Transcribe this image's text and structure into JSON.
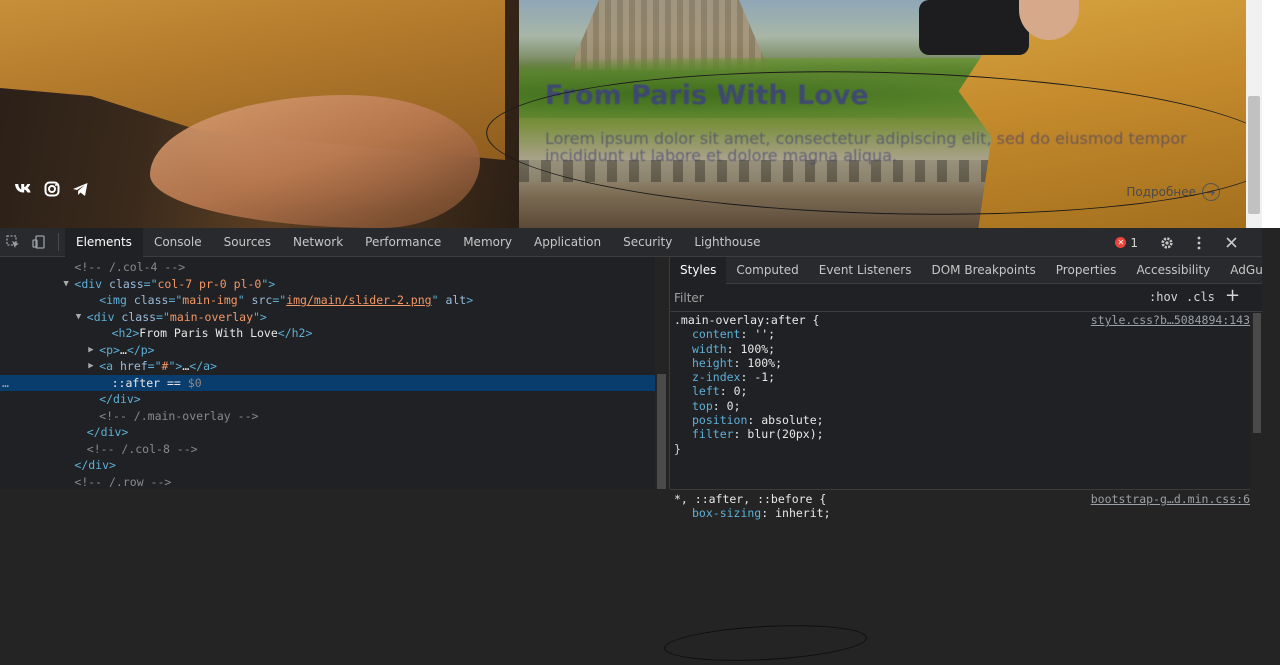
{
  "site": {
    "overlay_title": "From Paris With Love",
    "overlay_text": "Lorem ipsum dolor sit amet, consectetur adipiscing elit, sed do eiusmod tempor incididunt ut labore et dolore magna aliqua.",
    "more_link": "Подробнее",
    "socials": [
      "vk-icon",
      "instagram-icon",
      "telegram-icon"
    ]
  },
  "devtools": {
    "main_tabs": [
      "Elements",
      "Console",
      "Sources",
      "Network",
      "Performance",
      "Memory",
      "Application",
      "Security",
      "Lighthouse"
    ],
    "active_tab": "Elements",
    "error_count": "1",
    "elements_lines": [
      {
        "indent": 6,
        "parts": [
          [
            "cmt",
            "<!-- /.col-4 -->"
          ]
        ]
      },
      {
        "indent": 6,
        "tri": "▼",
        "parts": [
          [
            "tag",
            "<div "
          ],
          [
            "attr",
            "class"
          ],
          [
            "tag",
            "=\""
          ],
          [
            "val",
            "col-7 pr-0 pl-0"
          ],
          [
            "tag",
            "\">"
          ]
        ]
      },
      {
        "indent": 8,
        "parts": [
          [
            "tag",
            "<img "
          ],
          [
            "attr",
            "class"
          ],
          [
            "tag",
            "=\""
          ],
          [
            "val",
            "main-img"
          ],
          [
            "tag",
            "\" "
          ],
          [
            "attr",
            "src"
          ],
          [
            "tag",
            "=\""
          ],
          [
            "val",
            "img/main/slider-2.png"
          ],
          [
            "tag",
            "\" "
          ],
          [
            "attr",
            "alt"
          ],
          [
            "tag",
            ">"
          ]
        ]
      },
      {
        "indent": 7,
        "tri": "▼",
        "parts": [
          [
            "tag",
            "<div "
          ],
          [
            "attr",
            "class"
          ],
          [
            "tag",
            "=\""
          ],
          [
            "val",
            "main-overlay"
          ],
          [
            "tag",
            "\">"
          ]
        ]
      },
      {
        "indent": 9,
        "parts": [
          [
            "tag",
            "<h2>"
          ],
          [
            "txt",
            "From Paris With Love"
          ],
          [
            "tag",
            "</h2>"
          ]
        ]
      },
      {
        "indent": 8,
        "tri": "▶",
        "parts": [
          [
            "tag",
            "<p>"
          ],
          [
            "txt",
            "…"
          ],
          [
            "tag",
            "</p>"
          ]
        ]
      },
      {
        "indent": 8,
        "tri": "▶",
        "parts": [
          [
            "tag",
            "<a "
          ],
          [
            "attr",
            "href"
          ],
          [
            "tag",
            "=\""
          ],
          [
            "val",
            "#"
          ],
          [
            "tag",
            "\">"
          ],
          [
            "txt",
            "…"
          ],
          [
            "tag",
            "</a>"
          ]
        ]
      },
      {
        "indent": 9,
        "sel": true,
        "parts": [
          [
            "txt",
            "::after == "
          ],
          [
            "cmt",
            "$0"
          ]
        ]
      },
      {
        "indent": 8,
        "parts": [
          [
            "tag",
            "</div>"
          ]
        ]
      },
      {
        "indent": 8,
        "parts": [
          [
            "cmt",
            "<!-- /.main-overlay -->"
          ]
        ]
      },
      {
        "indent": 7,
        "parts": [
          [
            "tag",
            "</div>"
          ]
        ]
      },
      {
        "indent": 7,
        "parts": [
          [
            "cmt",
            "<!-- /.col-8 -->"
          ]
        ]
      },
      {
        "indent": 6,
        "parts": [
          [
            "tag",
            "</div>"
          ]
        ]
      },
      {
        "indent": 6,
        "parts": [
          [
            "cmt",
            "<!-- /.row -->"
          ]
        ]
      }
    ],
    "styles_tabs": [
      "Styles",
      "Computed",
      "Event Listeners",
      "DOM Breakpoints",
      "Properties",
      "Accessibility",
      "AdGuard"
    ],
    "filter_placeholder": "Filter",
    "hov": ":hov",
    "cls": ".cls",
    "rule1": {
      "selector": ".main-overlay:after {",
      "source": "style.css?b…5084894:143",
      "props": [
        [
          "content",
          "'';"
        ],
        [
          "width",
          "100%;"
        ],
        [
          "height",
          "100%;"
        ],
        [
          "z-index",
          "-1;"
        ],
        [
          "left",
          "0;"
        ],
        [
          "top",
          "0;"
        ],
        [
          "position",
          "absolute;"
        ],
        [
          "filter",
          "blur(20px);"
        ]
      ],
      "close": "}"
    },
    "rule2": {
      "selector": "*, ::after, ::before {",
      "source": "bootstrap-g…d.min.css:6",
      "props": [
        [
          "box-sizing",
          "inherit;"
        ]
      ]
    }
  }
}
